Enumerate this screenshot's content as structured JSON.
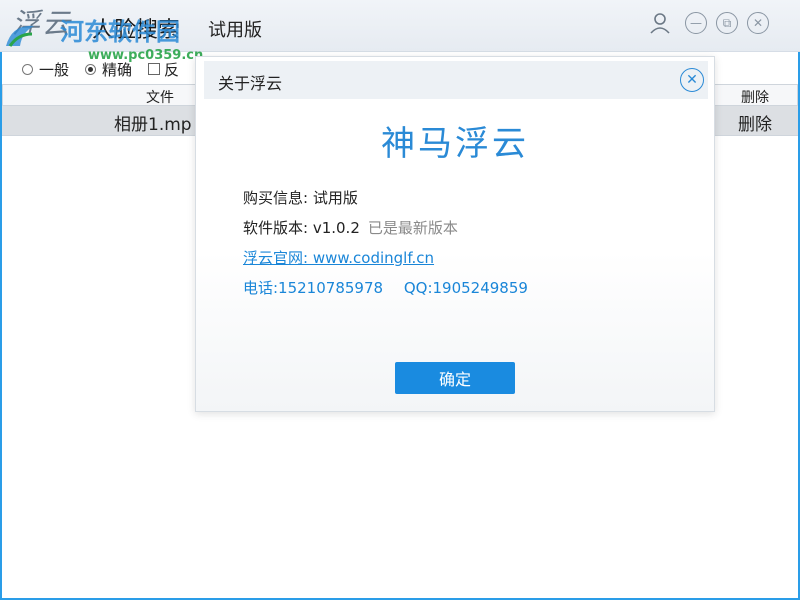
{
  "titlebar": {
    "logo": "浮云",
    "watermark_text": "河东软件园",
    "watermark_url": "www.pc0359.cn",
    "app_title": "人脸搜索",
    "edition": "试用版",
    "user_icon": "user-icon",
    "minimize_icon": "minimize-icon",
    "restore_icon": "restore-icon",
    "close_icon": "close-icon"
  },
  "options": {
    "general": "一般",
    "precise": "精确",
    "reverse": "反"
  },
  "table": {
    "headers": {
      "file": "文件",
      "delete": "删除"
    },
    "rows": [
      {
        "file": "相册1.mp",
        "delete": "删除"
      }
    ]
  },
  "dialog": {
    "title": "关于浮云",
    "brand": "神马浮云",
    "purchase_label": "购买信息: ",
    "purchase_value": "试用版",
    "version_label": "软件版本: ",
    "version_value": "v1.0.2",
    "version_status": "已是最新版本",
    "website": "浮云官网: www.codinglf.cn",
    "phone": "电话:15210785978",
    "qq": "QQ:1905249859",
    "ok_button": "确定"
  },
  "colors": {
    "accent": "#1a8be0",
    "link": "#1a86d8",
    "watermark_blue": "#2a8ad6",
    "watermark_green": "#2aa54a"
  }
}
